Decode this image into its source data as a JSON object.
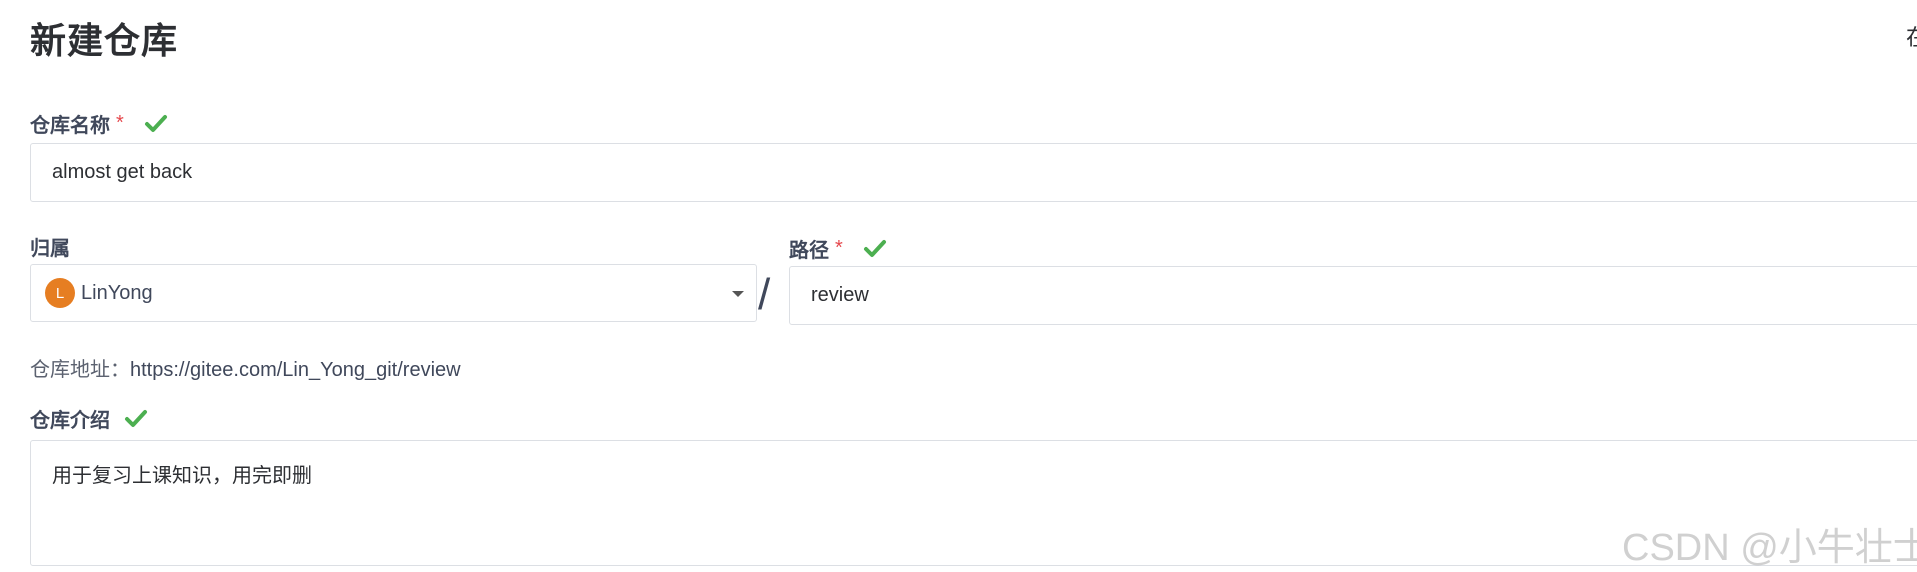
{
  "page": {
    "title": "新建仓库",
    "corner_text": "在"
  },
  "repo_name": {
    "label": "仓库名称",
    "required_mark": "*",
    "value": "almost get back"
  },
  "owner": {
    "label": "归属",
    "avatar_letter": "L",
    "value": "LinYong",
    "avatar_color": "#e67e22"
  },
  "separator": "/",
  "path": {
    "label": "路径",
    "required_mark": "*",
    "value": "review"
  },
  "address": {
    "prefix": "仓库地址：",
    "url": "https://gitee.com/Lin_Yong_git/review"
  },
  "description": {
    "label": "仓库介绍",
    "value": "用于复习上课知识，用完即删"
  },
  "watermark": "CSDN @小牛壮士",
  "colors": {
    "check": "#4caf50",
    "required": "#e5484d"
  },
  "icons": {
    "check": "check-icon",
    "dropdown": "chevron-down-icon"
  }
}
